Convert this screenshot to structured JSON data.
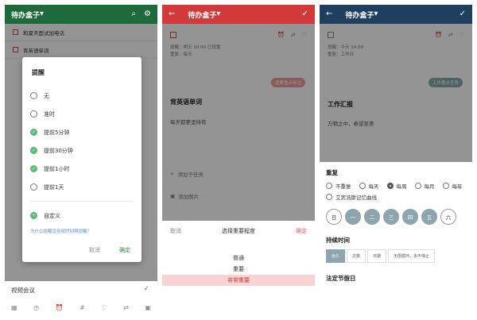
{
  "screen1": {
    "title": "待办盒子",
    "tasks": [
      "和夏天面试加电话",
      "背英语单词"
    ],
    "dialog": {
      "title": "提醒",
      "options": [
        "无",
        "准时",
        "提前5分钟",
        "提前30分钟",
        "提前1小时",
        "提前1天"
      ],
      "selected": [
        2,
        3,
        4
      ],
      "custom": "自定义",
      "link": "为什么提醒没有按时到期提醒？",
      "cancel": "取消",
      "confirm": "确定"
    },
    "footer_task": "视频会议"
  },
  "screen2": {
    "title": "待办盒子",
    "meta_line1": "提醒：明天 10:00 已设置",
    "meta_line2": "重复：每天",
    "tag": "重要重点标注",
    "task_title": "背英语单词",
    "task_note": "每天都要坚持背",
    "add_subtask": "添加子任务",
    "add_image": "添加图片",
    "sheet": {
      "cancel": "取消",
      "title": "选择重要程度",
      "confirm": "确定",
      "choices": [
        "普通",
        "重要",
        "非常重要"
      ],
      "selected_index": 2
    }
  },
  "screen3": {
    "title": "待办盒子",
    "meta_line1": "提醒：今天 14:00",
    "meta_line2": "重复：工作日",
    "tag": "工作重点任务",
    "task_title": "工作汇报",
    "task_note": "万物之中，希望至美",
    "repeat": {
      "heading": "重复",
      "options": [
        "不重复",
        "每天",
        "每周",
        "每月",
        "每年",
        "艾宾浩斯记忆曲线"
      ],
      "selected_index": 2
    },
    "days": [
      "日",
      "一",
      "二",
      "三",
      "四",
      "五",
      "六"
    ],
    "days_selected": [
      1,
      2,
      3,
      4,
      5
    ],
    "duration": {
      "heading": "持续时间",
      "options": [
        "永久",
        "次数",
        "日期",
        "无限循环，永不停止"
      ],
      "selected_index": 0
    },
    "holiday_heading": "法定节假日"
  },
  "colors": {
    "green": "#1f6a3a",
    "red": "#d23a3a",
    "navy": "#1f3f60"
  }
}
